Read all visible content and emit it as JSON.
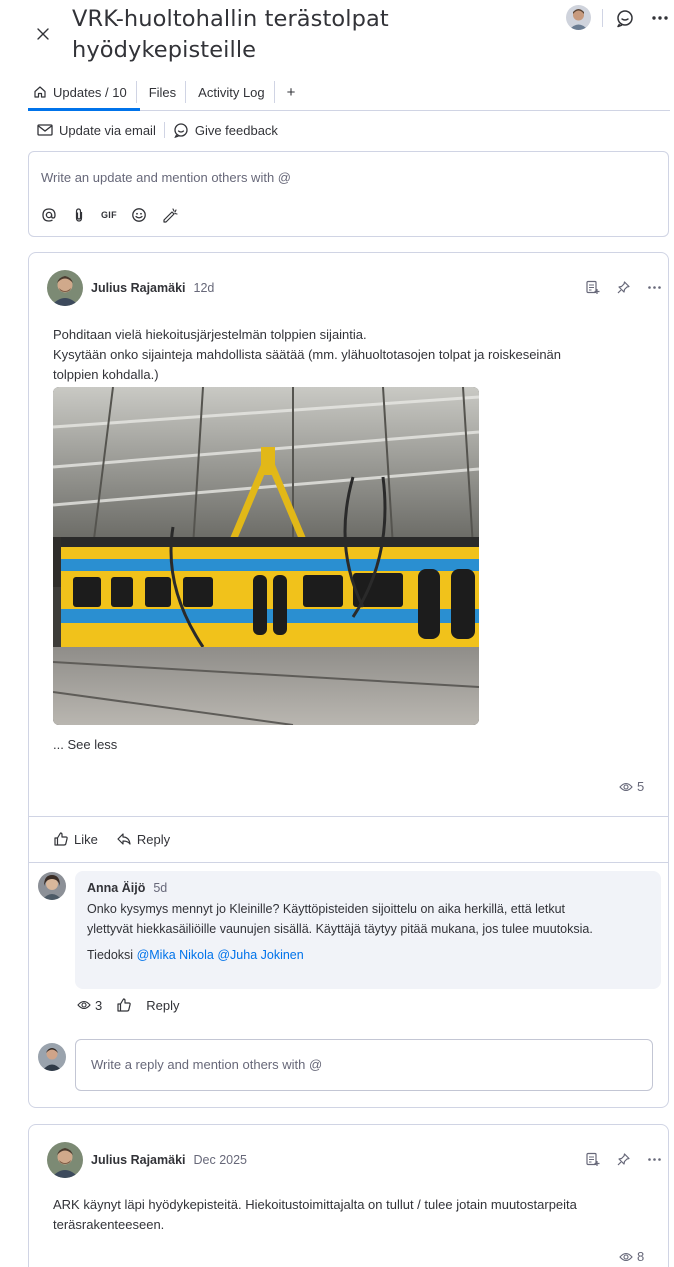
{
  "header": {
    "title": "VRK-huoltohallin terästolpat hyödykepisteille"
  },
  "tabs": [
    {
      "label": "Updates / 10",
      "icon": "home-icon",
      "active": true
    },
    {
      "label": "Files"
    },
    {
      "label": "Activity Log"
    },
    {
      "label": "+"
    }
  ],
  "sub_actions": {
    "email": "Update via email",
    "feedback": "Give feedback"
  },
  "composer": {
    "placeholder": "Write an update and mention others with @",
    "tools": [
      "at-icon",
      "attach-icon",
      "gif-icon",
      "emoji-icon",
      "format-icon"
    ],
    "gif_label": "GIF"
  },
  "posts": [
    {
      "author": "Julius Rajamäki",
      "time": "12d",
      "lines": [
        "Pohditaan vielä hiekoitusjärjestelmän tolppien sijaintia.",
        "Kysytään onko sijainteja mahdollista säätää (mm. ylähuoltotasojen tolpat ja roiskeseinän",
        "tolppien kohdalla.)"
      ],
      "see_less": "... See less",
      "views": "5",
      "like_label": "Like",
      "reply_label": "Reply",
      "reply": {
        "author": "Anna Äijö",
        "time": "5d",
        "lines": [
          "Onko kysymys mennyt jo Kleinille? Käyttöpisteiden sijoittelu on aika herkillä, että letkut",
          "ylettyvät hiekkasäiliöille vaunujen sisällä. Käyttäjä täytyy pitää mukana, jos tulee muutoksia."
        ],
        "cc_prefix": "Tiedoksi",
        "mentions": [
          "@Mika Nikola",
          "@Juha Jokinen"
        ],
        "views": "3",
        "reply_label": "Reply"
      },
      "reply_placeholder": "Write a reply and mention others with @"
    },
    {
      "author": "Julius Rajamäki",
      "time": "Dec 2025",
      "lines": [
        "ARK käynyt läpi hyödykepisteitä. Hiekoitustoimittajalta on tullut / tulee jotain muutostarpeita",
        "teräsrakenteeseen."
      ],
      "views": "8"
    }
  ],
  "colors": {
    "accent": "#0073ea",
    "border": "#d0d4e4",
    "text": "#323338",
    "muted": "#676879",
    "reply_bg": "#f1f3f8"
  }
}
